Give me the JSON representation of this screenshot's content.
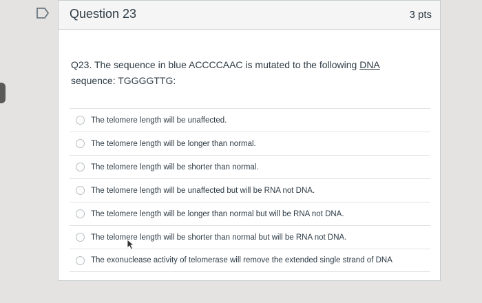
{
  "question": {
    "title": "Question 23",
    "points": "3 pts",
    "text_line1_pre": "Q23. The sequence in blue ACCCCAAC is mutated to the following ",
    "text_line1_link": "DNA",
    "text_line2": "sequence: TGGGGTTG:"
  },
  "answers": [
    {
      "label": "The telomere length will be unaffected."
    },
    {
      "label": "The telomere length will be longer than normal."
    },
    {
      "label": "The telomere length will be shorter than normal."
    },
    {
      "label": "The telomere length will be unaffected but will be RNA not DNA."
    },
    {
      "label": "The telomere length will be longer than normal but will be RNA not DNA."
    },
    {
      "label": "The telomere length will be shorter than normal but will be RNA not DNA."
    },
    {
      "label": "The exonuclease activity of telomerase will remove the extended single strand of DNA"
    }
  ],
  "icons": {
    "flag": "flag-icon",
    "cursor": "mouse-cursor-icon"
  },
  "colors": {
    "text": "#2d3b45",
    "border": "#c7cdd1",
    "header_bg": "#f5f5f5",
    "background": "#e4e3e1"
  }
}
